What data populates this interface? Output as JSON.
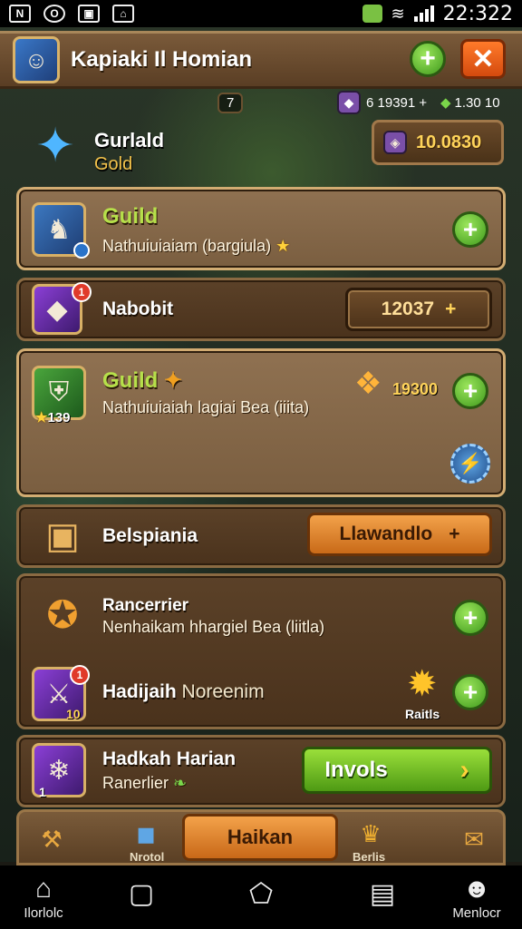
{
  "status_bar": {
    "time": "22:322"
  },
  "header": {
    "title": "Kapiaki Il Homian"
  },
  "resources": {
    "left_value": "7",
    "mid_value": "6 19391 +",
    "right_value": "1.30 10"
  },
  "guild_info": {
    "name": "Gurlald",
    "subtitle": "Gold",
    "gold_value": "10.0830"
  },
  "cards": {
    "guild1": {
      "title": "Guild",
      "desc": "Nathuiuiaiam (bargiula)"
    },
    "nabobit": {
      "title": "Nabobit",
      "badge": "1",
      "value": "12037",
      "value_icon": "+"
    },
    "guild2": {
      "title": "Guild",
      "desc": "Nathuiuiaiah lagiai Bea (iiita)",
      "tile_level": "139",
      "reward_value": "19300"
    },
    "belspiania": {
      "title": "Belspiania",
      "button_label": "Llawandlo",
      "button_icon": "+"
    },
    "rancerrier": {
      "title": "Rancerrier",
      "desc": "Nenhaikam hhargiel Bea (liitla)"
    },
    "hadijaih": {
      "title": "Hadijaih",
      "title_suffix": "Noreenim",
      "badge": "1",
      "tile_level": "10",
      "reward_label": "Raitls"
    },
    "hadkah": {
      "title": "Hadkah Harian",
      "subtitle": "Ranerlier",
      "tile_level": "1",
      "button_label": "Invols",
      "button_icon": "›"
    }
  },
  "tabbar": {
    "left_label": "",
    "second_label": "Nrotol",
    "center_label": "Haikan",
    "fourth_label": "Berlis",
    "right_label": ""
  },
  "navbar": {
    "home_label": "Ilorlolc",
    "menu_label": "Menlocr"
  },
  "colors": {
    "accent_green": "#9adf3a",
    "accent_orange": "#f3a24a",
    "panel_brown": "#5b4128",
    "gold_text": "#ffd45a"
  }
}
